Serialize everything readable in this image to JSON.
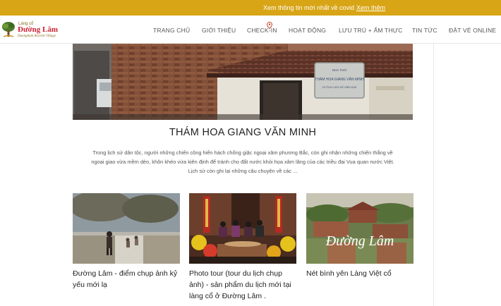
{
  "topbar": {
    "text": "Xem thông tin mới nhất về covid",
    "link": "Xem thêm"
  },
  "logo": {
    "small": "Làng cổ",
    "main": "Đường Lâm",
    "sub": "Duongham Ancient Village"
  },
  "nav": [
    "TRANG CHỦ",
    "GIỚI THIỆU",
    "CHECK-IN",
    "HOẠT ĐỘNG",
    "LƯU TRÚ + ẨM THỰC",
    "TIN TỨC",
    "ĐẶT VÉ ONLINE"
  ],
  "hero": {
    "sign_lines": [
      "NHÀ THỜ",
      "THÁM HOA GIANG VĂN MINH",
      "DI TÍCH LỊCH SỬ VĂN HOÁ"
    ]
  },
  "article": {
    "title": "THÁM HOA GIANG VĂN MINH",
    "excerpt": "Trong lịch sử dân tộc, người những chiến công hiển hách chống giặc ngoại xâm phương Bắc, còn ghi nhận những chiến thắng về ngoại giao vừa mềm dẻo, khôn khéo vừa kiên định để tránh cho đất nước khỏi họa xâm lăng của các triều đại Vua quan nước Việt. Lịch sử còn ghi lại những câu chuyện về các ..."
  },
  "cards": [
    {
      "title": "Đường Lâm - điểm chụp ảnh kỷ yếu mới lạ"
    },
    {
      "title": "Photo tour (tour du lịch chụp ảnh) - sản phẩm du lịch mới tại làng cổ ở Đường Lâm ."
    },
    {
      "title": "Nét bình yên Làng Việt cổ",
      "overlay": "Đường Lâm"
    }
  ],
  "colors": {
    "topbar": "#d8a516",
    "accent": "#c23b2a",
    "divider": "#e8e8e8"
  }
}
